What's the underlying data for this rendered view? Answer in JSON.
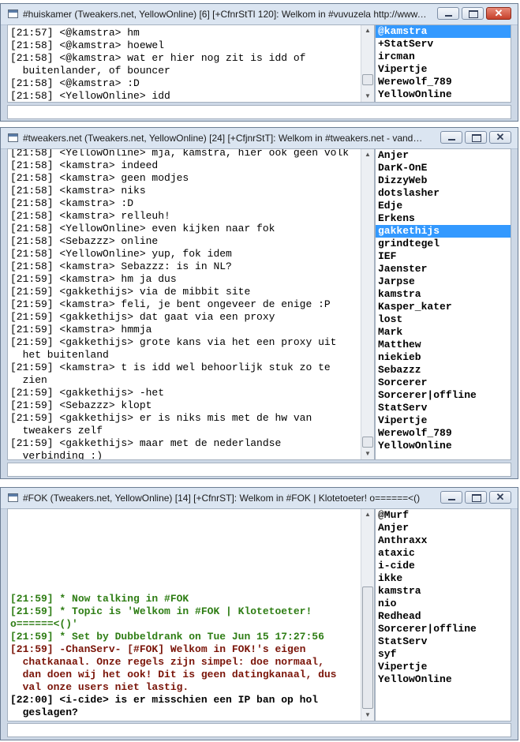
{
  "windows": [
    {
      "title": "#huiskamer (Tweakers.net, YellowOnline) [6] [+CfnrStTl 120]: Welkom in #vuvuzela http://www....",
      "lines": [
        {
          "text": "[21:57] <@kamstra> hm",
          "color": "normal"
        },
        {
          "text": "[21:58] <@kamstra> hoewel",
          "color": "normal"
        },
        {
          "text": "[21:58] <@kamstra> wat er hier nog zit is idd of",
          "color": "normal"
        },
        {
          "text": "  buitenlander, of bouncer",
          "color": "normal"
        },
        {
          "text": "[21:58] <@kamstra> :D",
          "color": "normal"
        },
        {
          "text": "[21:58] <YellowOnline> idd",
          "color": "normal"
        }
      ],
      "nicks": [
        "@kamstra",
        "+StatServ",
        "ircman",
        "Vipertje",
        "Werewolf_789",
        "YellowOnline"
      ],
      "selected_nick": "@kamstra",
      "close_style": "red",
      "input_value": ""
    },
    {
      "title": "#tweakers.net (Tweakers.net, YellowOnline) [24] [+CfjnrStT]: Welkom in #tweakers.net - vandaag...",
      "lines": [
        {
          "text": "[21:58] <YellowOnline> mja, kamstra, hier ook geen volk",
          "color": "normal"
        },
        {
          "text": "[21:58] <kamstra> indeed",
          "color": "normal"
        },
        {
          "text": "[21:58] <kamstra> geen modjes",
          "color": "normal"
        },
        {
          "text": "[21:58] <kamstra> niks",
          "color": "normal"
        },
        {
          "text": "[21:58] <kamstra> :D",
          "color": "normal"
        },
        {
          "text": "[21:58] <kamstra> relleuh!",
          "color": "normal"
        },
        {
          "text": "[21:58] <YellowOnline> even kijken naar fok",
          "color": "normal"
        },
        {
          "text": "[21:58] <Sebazzz> online",
          "color": "normal"
        },
        {
          "text": "[21:58] <YellowOnline> yup, fok idem",
          "color": "normal"
        },
        {
          "text": "[21:58] <kamstra> Sebazzz: is in NL?",
          "color": "normal"
        },
        {
          "text": "[21:59] <kamstra> hm ja dus",
          "color": "normal"
        },
        {
          "text": "[21:59] <gakkethijs> via de mibbit site",
          "color": "normal"
        },
        {
          "text": "[21:59] <kamstra> feli, je bent ongeveer de enige :P",
          "color": "normal"
        },
        {
          "text": "[21:59] <gakkethijs> dat gaat via een proxy",
          "color": "normal"
        },
        {
          "text": "[21:59] <kamstra> hmmja",
          "color": "normal"
        },
        {
          "text": "[21:59] <gakkethijs> grote kans via het een proxy uit",
          "color": "normal"
        },
        {
          "text": "  het buitenland",
          "color": "normal"
        },
        {
          "text": "[21:59] <kamstra> t is idd wel behoorlijk stuk zo te",
          "color": "normal"
        },
        {
          "text": "  zien",
          "color": "normal"
        },
        {
          "text": "[21:59] <gakkethijs> -het",
          "color": "normal"
        },
        {
          "text": "[21:59] <Sebazzz> klopt",
          "color": "normal"
        },
        {
          "text": "[21:59] <gakkethijs> er is niks mis met de hw van",
          "color": "normal"
        },
        {
          "text": "  tweakers zelf",
          "color": "normal"
        },
        {
          "text": "[21:59] <gakkethijs> maar met de nederlandse",
          "color": "normal"
        },
        {
          "text": "  verbinding :)",
          "color": "normal"
        }
      ],
      "nicks": [
        "Anjer",
        "DarK-OnE",
        "DizzyWeb",
        "dotslasher",
        "Edje",
        "Erkens",
        "gakkethijs",
        "grindtegel",
        "IEF",
        "Jaenster",
        "Jarpse",
        "kamstra",
        "Kasper_kater",
        "lost",
        "Mark",
        "Matthew",
        "niekieb",
        "Sebazzz",
        "Sorcerer",
        "Sorcerer|offline",
        "StatServ",
        "Vipertje",
        "Werewolf_789",
        "YellowOnline"
      ],
      "selected_nick": "gakkethijs",
      "close_style": "plain",
      "input_value": ""
    },
    {
      "title": "#FOK (Tweakers.net, YellowOnline) [14] [+CfnrST]: Welkom in #FOK | Klotetoeter! o======<()",
      "lines": [
        {
          "text": "[21:59] * Now talking in #FOK",
          "color": "green"
        },
        {
          "text": "[21:59] * Topic is 'Welkom in #FOK | Klotetoeter!",
          "color": "green"
        },
        {
          "text": "o======<()'",
          "color": "green"
        },
        {
          "text": "[21:59] * Set by Dubbeldrank on Tue Jun 15 17:27:56",
          "color": "green"
        },
        {
          "text": "[21:59] -ChanServ- [#FOK] Welkom in FOK!'s eigen",
          "color": "maroon"
        },
        {
          "text": "  chatkanaal. Onze regels zijn simpel: doe normaal,",
          "color": "maroon"
        },
        {
          "text": "  dan doen wij het ook! Dit is geen datingkanaal, dus",
          "color": "maroon"
        },
        {
          "text": "  val onze users niet lastig.",
          "color": "maroon"
        },
        {
          "text": "[22:00] <i-cide> is er misschien een IP ban op hol",
          "color": "black"
        },
        {
          "text": "  geslagen?",
          "color": "black"
        }
      ],
      "nicks": [
        "@Murf",
        "Anjer",
        "Anthraxx",
        "ataxic",
        "i-cide",
        "ikke",
        "kamstra",
        "nio",
        "Redhead",
        "Sorcerer|offline",
        "StatServ",
        "syf",
        "Vipertje",
        "YellowOnline"
      ],
      "selected_nick": "",
      "close_style": "plain",
      "input_value": ""
    }
  ]
}
